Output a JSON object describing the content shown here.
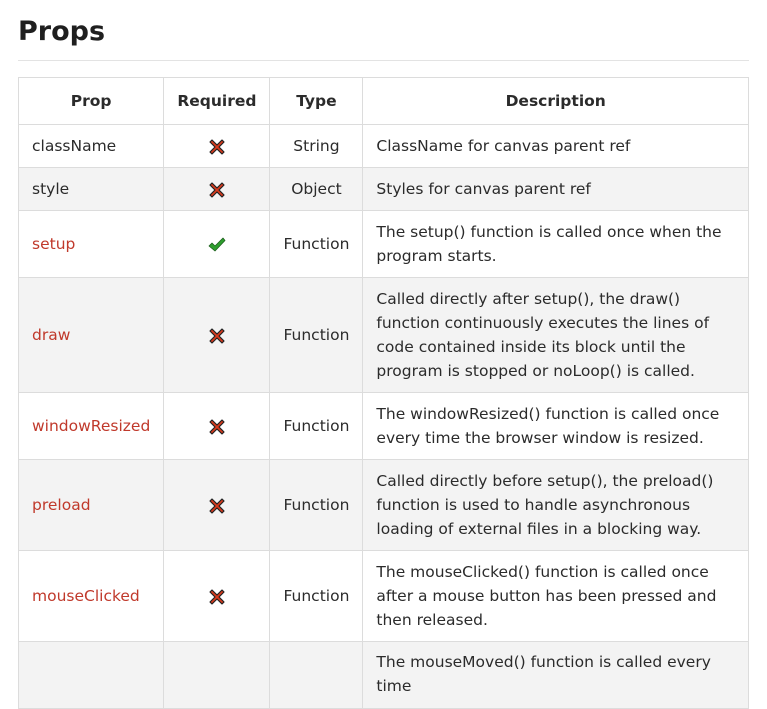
{
  "title": "Props",
  "table": {
    "headers": {
      "prop": "Prop",
      "required": "Required",
      "type": "Type",
      "description": "Description"
    },
    "rows": [
      {
        "prop": "className",
        "required": false,
        "required_icon": "cross-icon",
        "type": "String",
        "description": "ClassName for canvas parent ref",
        "is_function": false
      },
      {
        "prop": "style",
        "required": false,
        "required_icon": "cross-icon",
        "type": "Object",
        "description": "Styles for canvas parent ref",
        "is_function": false
      },
      {
        "prop": "setup",
        "required": true,
        "required_icon": "check-icon",
        "type": "Function",
        "description": "The setup() function is called once when the program starts.",
        "is_function": true
      },
      {
        "prop": "draw",
        "required": false,
        "required_icon": "cross-icon",
        "type": "Function",
        "description": "Called directly after setup(), the draw() function continuously executes the lines of code contained inside its block until the program is stopped or noLoop() is called.",
        "is_function": true
      },
      {
        "prop": "windowResized",
        "required": false,
        "required_icon": "cross-icon",
        "type": "Function",
        "description": "The windowResized() function is called once every time the browser window is resized.",
        "is_function": true
      },
      {
        "prop": "preload",
        "required": false,
        "required_icon": "cross-icon",
        "type": "Function",
        "description": "Called directly before setup(), the preload() function is used to handle asynchronous loading of external files in a blocking way.",
        "is_function": true
      },
      {
        "prop": "mouseClicked",
        "required": false,
        "required_icon": "cross-icon",
        "type": "Function",
        "description": "The mouseClicked() function is called once after a mouse button has been pressed and then released.",
        "is_function": true
      },
      {
        "prop": "",
        "required": null,
        "required_icon": "",
        "type": "",
        "description": "The mouseMoved() function is called every time",
        "is_function": true
      }
    ]
  },
  "colors": {
    "function_name": "#c0392b",
    "cross": "#d93a1e",
    "check": "#2e9e2e",
    "row_stripe": "#f3f3f3"
  }
}
